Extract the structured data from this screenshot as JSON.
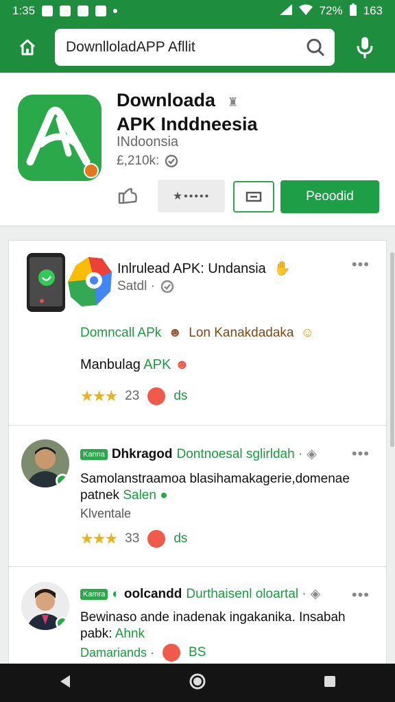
{
  "status": {
    "time": "1:35",
    "battery": "72%",
    "extra": "163"
  },
  "search": {
    "query": "DownlloladAPP Afllit"
  },
  "app": {
    "title_line1": "Downloada",
    "title_line2": "APK Inddneesia",
    "developer": "INdoonsia",
    "size": "£,210k:",
    "rating_dots": "★•••••",
    "install_label": "Peoodid"
  },
  "feed": {
    "card1": {
      "title": "Inlrulead APK: Undansia",
      "sub": "Satdl ·",
      "line1_green": "Domncall APk",
      "line1_brown": "Lon Kanakdadaka",
      "line2_black": "Manbulag",
      "line2_green": "APK",
      "count": "23",
      "react_label": "ds"
    },
    "card2": {
      "tag": "Kanna",
      "name": "Dhkragod",
      "meta": "Dontnoesal sglirldah ·",
      "body_black": "Samolanstraamoa blasihamakagerie,domenae patnek",
      "body_green": "Salen",
      "foot": "Klventale",
      "count": "33",
      "react_label": "ds"
    },
    "card3": {
      "tag": "Kamra",
      "name": "oolcandd",
      "meta": "Durthaisenl oloartal ·",
      "body_black": "Bewinaso ande inadenak ingakanika. Insabah pabk:",
      "body_green": "Ahnk",
      "foot_label": "Damariands ·",
      "react_label": "BS"
    }
  }
}
